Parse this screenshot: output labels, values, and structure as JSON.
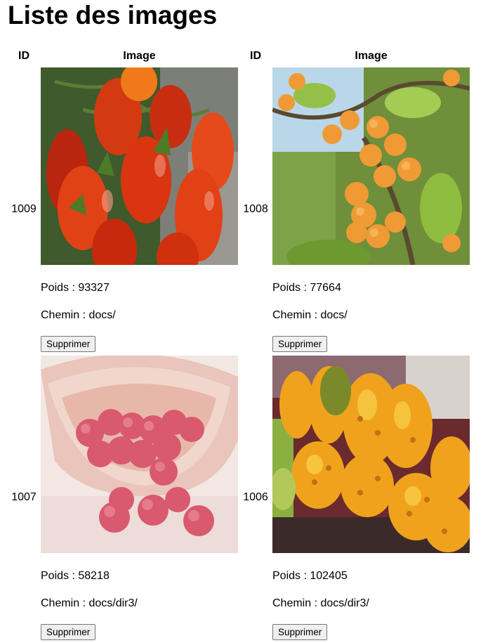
{
  "page": {
    "title": "Liste des images"
  },
  "table": {
    "headers": {
      "id": "ID",
      "image": "Image"
    },
    "delete_label": "Supprimer",
    "rows": [
      {
        "id": "1009",
        "weight": "Poids : 93327",
        "path": "Chemin : docs/",
        "subject": "tomatoes"
      },
      {
        "id": "1008",
        "weight": "Poids : 77664",
        "path": "Chemin : docs/",
        "subject": "apricots"
      },
      {
        "id": "1007",
        "weight": "Poids : 58218",
        "path": "Chemin : docs/dir3/",
        "subject": "lychees"
      },
      {
        "id": "1006",
        "weight": "Poids : 102405",
        "path": "Chemin : docs/dir3/",
        "subject": "kiwano-melons"
      }
    ]
  }
}
